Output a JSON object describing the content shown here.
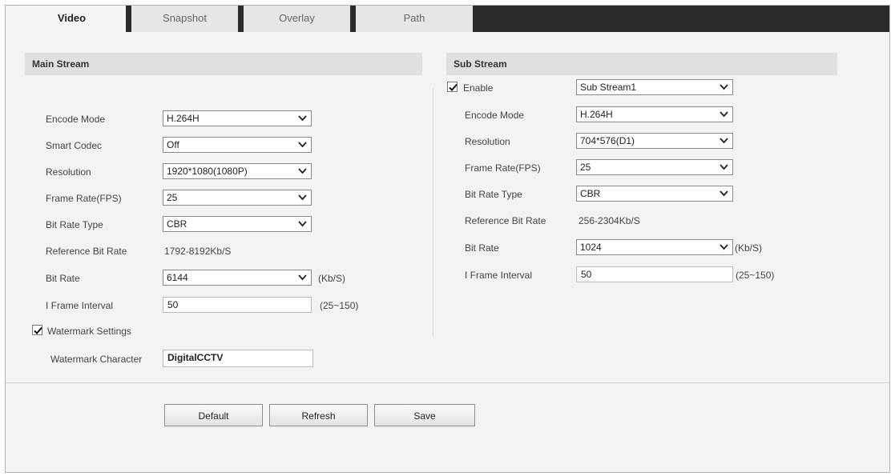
{
  "tabs": [
    "Video",
    "Snapshot",
    "Overlay",
    "Path"
  ],
  "main": {
    "title": "Main Stream",
    "encode_mode": {
      "label": "Encode Mode",
      "value": "H.264H"
    },
    "smart_codec": {
      "label": "Smart Codec",
      "value": "Off"
    },
    "resolution": {
      "label": "Resolution",
      "value": "1920*1080(1080P)"
    },
    "frame_rate": {
      "label": "Frame Rate(FPS)",
      "value": "25"
    },
    "bit_rate_type": {
      "label": "Bit Rate Type",
      "value": "CBR"
    },
    "reference_bit_rate": {
      "label": "Reference Bit Rate",
      "value": "1792-8192Kb/S"
    },
    "bit_rate": {
      "label": "Bit Rate",
      "value": "6144",
      "unit": "(Kb/S)"
    },
    "i_frame": {
      "label": "I Frame Interval",
      "value": "50",
      "range": "(25~150)"
    },
    "watermark_settings": {
      "label": "Watermark Settings",
      "checked": true
    },
    "watermark_character": {
      "label": "Watermark Character",
      "value": "DigitalCCTV"
    }
  },
  "sub": {
    "title": "Sub Stream",
    "enable": {
      "label": "Enable",
      "checked": true,
      "value": "Sub Stream1"
    },
    "encode_mode": {
      "label": "Encode Mode",
      "value": "H.264H"
    },
    "resolution": {
      "label": "Resolution",
      "value": "704*576(D1)"
    },
    "frame_rate": {
      "label": "Frame Rate(FPS)",
      "value": "25"
    },
    "bit_rate_type": {
      "label": "Bit Rate Type",
      "value": "CBR"
    },
    "reference_bit_rate": {
      "label": "Reference Bit Rate",
      "value": "256-2304Kb/S"
    },
    "bit_rate": {
      "label": "Bit Rate",
      "value": "1024",
      "unit": "(Kb/S)"
    },
    "i_frame": {
      "label": "I Frame Interval",
      "value": "50",
      "range": "(25~150)"
    }
  },
  "buttons": {
    "default": "Default",
    "refresh": "Refresh",
    "save": "Save"
  },
  "colors": {
    "tab_bar": "#2b2b2b",
    "section_header": "#e0e0e0",
    "background": "#f3f3f3"
  }
}
